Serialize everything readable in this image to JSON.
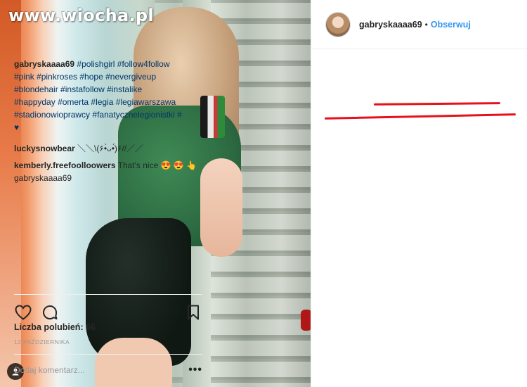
{
  "watermark": "www.wiocha.pl",
  "post": {
    "username": "gabryskaaaa69",
    "dot": "•",
    "follow_label": "Obserwuj",
    "caption_user": "gabryskaaaa69",
    "hashtags_line1": "#polishgirl #follow4follow",
    "hashtags_line2": "#pink #pinkroses #hope #nevergiveup",
    "hashtags_line3": "#blondehair #instafollow #instalike",
    "hashtags_line4a": "#happyday",
    "hashtags_line4b": "#omerta #legia #legiawarszawa",
    "hashtags_line5": "#stadionowioprawcy #fanatycznelegionistki #",
    "hashtags_line6": "♥"
  },
  "comments": [
    {
      "user": "luckysnowbear",
      "text": "＼＼\\(۶•̀ᴗ•́)۶//／／"
    },
    {
      "user": "kemberly.freefoolloowers",
      "text": "That's nice 😍 😍 👆",
      "extra": "gabryskaaaa69"
    }
  ],
  "likes_label": "Liczba polubień: 66",
  "date_label": "12 PAŹDZIERNIKA",
  "comment_placeholder": "Dodaj komentarz...",
  "more_label": "•••",
  "colors": {
    "link": "#003569",
    "follow": "#3897f0",
    "annotation": "#e8101a",
    "text": "#262626"
  },
  "icons": [
    "heart-icon",
    "comment-icon",
    "bookmark-icon",
    "user-tag-icon"
  ]
}
